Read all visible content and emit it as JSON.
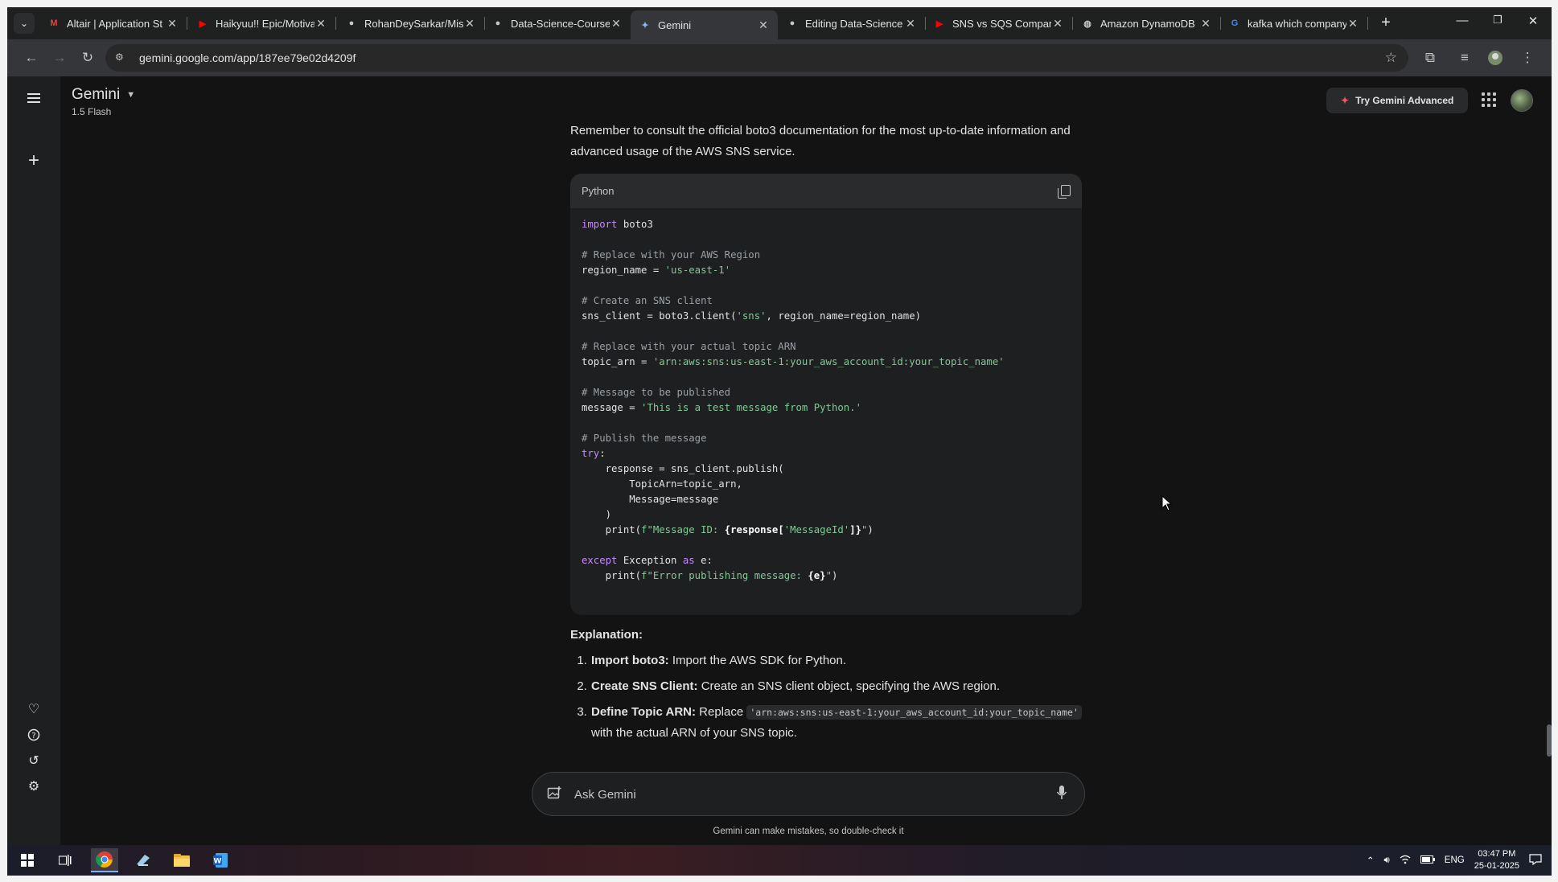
{
  "browser": {
    "tabs": [
      {
        "title": "Altair | Application St",
        "favicon": "gmail-icon",
        "color": "#ea4335"
      },
      {
        "title": "Haikyuu!! Epic/Motiva",
        "favicon": "youtube-icon",
        "color": "#ff0000"
      },
      {
        "title": "RohanDeySarkar/Mis",
        "favicon": "github-icon",
        "color": "#c4c7c5"
      },
      {
        "title": "Data-Science-Course",
        "favicon": "github-icon",
        "color": "#c4c7c5"
      },
      {
        "title": "Gemini",
        "favicon": "gemini-icon",
        "color": "#8ab4f8",
        "active": true
      },
      {
        "title": "Editing Data-Science",
        "favicon": "github-icon",
        "color": "#c4c7c5"
      },
      {
        "title": "SNS vs SQS Comparis",
        "favicon": "youtube-icon",
        "color": "#ff0000"
      },
      {
        "title": "Amazon DynamoDB",
        "favicon": "globe-icon",
        "color": "#c4c7c5"
      },
      {
        "title": "kafka which company",
        "favicon": "google-icon",
        "color": "#4285f4"
      }
    ],
    "url": "gemini.google.com/app/187ee79e02d4209f"
  },
  "app": {
    "name": "Gemini",
    "model": "1.5 Flash",
    "try_advanced": "Try Gemini Advanced"
  },
  "response": {
    "intro": "Remember to consult the official boto3 documentation for the most up-to-date information and advanced usage of the AWS SNS service.",
    "code_language": "Python",
    "code_lines": [
      [
        {
          "t": "import",
          "k": "k"
        },
        {
          "t": " boto3"
        }
      ],
      [],
      [
        {
          "t": "# Replace with your AWS Region",
          "k": "c"
        }
      ],
      [
        {
          "t": "region_name = "
        },
        {
          "t": "'us-east-1'",
          "k": "s"
        }
      ],
      [],
      [
        {
          "t": "# Create an SNS client",
          "k": "c"
        }
      ],
      [
        {
          "t": "sns_client = boto3.client("
        },
        {
          "t": "'sns'",
          "k": "s"
        },
        {
          "t": ", region_name=region_name)"
        }
      ],
      [],
      [
        {
          "t": "# Replace with your actual topic ARN",
          "k": "c"
        }
      ],
      [
        {
          "t": "topic_arn = "
        },
        {
          "t": "'arn:aws:sns:us-east-1:your_aws_account_id:your_topic_name'",
          "k": "s"
        }
      ],
      [],
      [
        {
          "t": "# Message to be published",
          "k": "c"
        }
      ],
      [
        {
          "t": "message = "
        },
        {
          "t": "'This is a test message from Python.'",
          "k": "s"
        }
      ],
      [],
      [
        {
          "t": "# Publish the message",
          "k": "c"
        }
      ],
      [
        {
          "t": "try",
          "k": "k"
        },
        {
          "t": ":"
        }
      ],
      [
        {
          "t": "    response = sns_client.publish("
        }
      ],
      [
        {
          "t": "        TopicArn=topic_arn,"
        }
      ],
      [
        {
          "t": "        Message=message"
        }
      ],
      [
        {
          "t": "    )"
        }
      ],
      [
        {
          "t": "    print("
        },
        {
          "t": "f\"Message ID: ",
          "k": "s"
        },
        {
          "t": "{response[",
          "k": "b"
        },
        {
          "t": "'MessageId'",
          "k": "s"
        },
        {
          "t": "]}",
          "k": "b"
        },
        {
          "t": "\"",
          "k": "s"
        },
        {
          "t": ")"
        }
      ],
      [],
      [
        {
          "t": "except",
          "k": "k"
        },
        {
          "t": " Exception "
        },
        {
          "t": "as",
          "k": "k"
        },
        {
          "t": " e:"
        }
      ],
      [
        {
          "t": "    print("
        },
        {
          "t": "f\"Error publishing message: ",
          "k": "s"
        },
        {
          "t": "{e}",
          "k": "b"
        },
        {
          "t": "\"",
          "k": "s"
        },
        {
          "t": ")"
        }
      ]
    ],
    "explanation_heading": "Explanation:",
    "explanation": [
      {
        "bold": "Import boto3:",
        "text": " Import the AWS SDK for Python."
      },
      {
        "bold": "Create SNS Client:",
        "text": " Create an SNS client object, specifying the AWS region."
      },
      {
        "bold": "Define Topic ARN:",
        "text": " Replace ",
        "code": "'arn:aws:sns:us-east-1:your_aws_account_id:your_topic_name'",
        "after": " with the actual ARN of your SNS topic."
      }
    ]
  },
  "input": {
    "placeholder": "Ask Gemini"
  },
  "disclaimer": "Gemini can make mistakes, so double-check it",
  "taskbar": {
    "language": "ENG",
    "time": "03:47 PM",
    "date": "25-01-2025"
  }
}
